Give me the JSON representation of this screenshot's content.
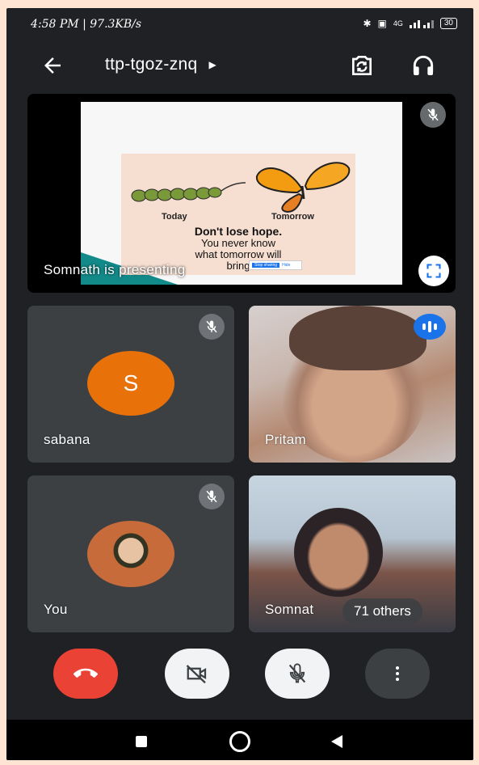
{
  "status_bar": {
    "time_net": "4:58 PM | 97.3KB/s",
    "battery": "30",
    "network": "4G"
  },
  "header": {
    "meeting_code": "ttp-tgoz-znq",
    "back_icon": "back-arrow-icon",
    "switch_camera_icon": "switch-camera-icon",
    "audio_icon": "headphones-icon"
  },
  "presentation": {
    "label": "Somnath is presenting",
    "slide": {
      "today": "Today",
      "tomorrow": "Tomorrow",
      "line1": "Don't lose hope.",
      "line2": "You never know",
      "line3": "what tomorrow will",
      "line4": "bring",
      "stop_sharing": "Stop sharing",
      "hide": "Hide"
    }
  },
  "participants": [
    {
      "name": "sabana",
      "initial": "S",
      "muted": true
    },
    {
      "name": "Pritam",
      "speaking": true
    },
    {
      "name": "You",
      "muted": true
    },
    {
      "name": "Somnat",
      "others_label": "71 others"
    }
  ],
  "controls": {
    "end_call": "end-call-icon",
    "camera": "camera-off-icon",
    "mic": "mic-off-icon",
    "more": "more-vert-icon"
  },
  "colors": {
    "background": "#202124",
    "tile": "#3c4043",
    "end_call": "#ea4335",
    "speaking": "#1a73e8",
    "avatar_s": "#e8710a"
  }
}
